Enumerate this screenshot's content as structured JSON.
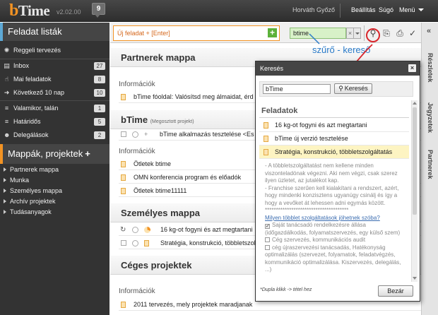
{
  "app": {
    "logo_mark": "b",
    "logo_text": "Time",
    "version": "v2.02.00",
    "notifications": "9"
  },
  "user": {
    "name": "Horváth Győző"
  },
  "topmenu": {
    "settings": "Beállítás",
    "help": "Súgó",
    "menu": "Menü"
  },
  "sidebar": {
    "tasks_title": "Feladat listák",
    "items": [
      {
        "label": "Reggeli tervezés",
        "icon": "sun-icon",
        "count": ""
      },
      {
        "label": "Inbox",
        "icon": "inbox-icon",
        "count": "27"
      },
      {
        "label": "Mai feladatok",
        "icon": "thumbs-up-icon",
        "count": "8"
      },
      {
        "label": "Következő 10 nap",
        "icon": "arrow-right-icon",
        "count": "10"
      },
      {
        "label": "Valamikor, talán",
        "icon": "bars-icon",
        "count": "1"
      },
      {
        "label": "Határidős",
        "icon": "bars-icon",
        "count": "5"
      },
      {
        "label": "Delegálások",
        "icon": "people-icon",
        "count": "2"
      }
    ],
    "folders_title": "Mappák, projektek",
    "folders_add": "+",
    "folders": [
      "Partnerek mappa",
      "Munka",
      "Személyes mappa",
      "Archív projektek",
      "Tudásanyagok"
    ]
  },
  "toolbar": {
    "new_task": "Új feladat + [Enter]",
    "new_task_add": "+",
    "search_value": "btime",
    "search_clear": "×"
  },
  "annotation": {
    "label": "szűrő - kereső"
  },
  "rail": {
    "collapse": "«",
    "tabs": [
      "Részletek",
      "Jegyzetek",
      "Partnerek"
    ]
  },
  "main": {
    "s1": {
      "title": "Partnerek mappa",
      "group": "Információk",
      "row": "bTime fóoldal: Valósítsd meg álmaidat, érd"
    },
    "s2": {
      "title": "bTime",
      "subtitle": "(Megosztott projekt)",
      "row": "bTime alkalmazás tesztelése <Es",
      "group": "Információk",
      "rows": [
        "Ötletek btime",
        "OMN konferencia program és előadók",
        "Ötletek btime11111"
      ]
    },
    "s3": {
      "title": "Személyes mappa",
      "rows": [
        "16 kg-ot fogyni és azt megtartani",
        "Stratégia, konstrukció, többletszolg"
      ]
    },
    "s4": {
      "title": "Céges projektek",
      "group": "Információk",
      "row": "2011 tervezés, mely projektek maradjanak"
    }
  },
  "dialog": {
    "title": "Keresés",
    "close": "×",
    "input": "bTime",
    "search_button": "Keresés",
    "section": "Feladatok",
    "results": [
      "16 kg-ot fogyni és azt megtartani",
      "bTime új verzió tesztelése",
      "Stratégia, konstrukció, többletszolgáltatás"
    ],
    "desc": [
      "- A többletszolgáltatást nem kellene minden viszonteladónak végezni. Aki nem végzi, csak szerez ilyen üzletet, az jutalékot kap.",
      "- Franchise szerűen kell kialakítani a rendszert, azért, hogy mindenki konzisztens ugyanúgy csinálj és így a hogy a vevőket át lehessen adni egymás között.",
      "**************************************"
    ],
    "link": "Milyen többlet szolgáltatások jöhetnek szóba?",
    "checks": [
      {
        "label": "Saját tanácsadó rendelkezésre állása (időgazdálkodás, folyamatszervezés, egy külső szem)",
        "checked": true
      },
      {
        "label": "Cég szervezés, kommunikációs audit",
        "checked": false
      },
      {
        "label": "cég újraszervezési tanácsadás, Hatékonyság optimalizálás (szervezet, folyamatok, feladatvégzés, kommunikáció optimalizálása. Kiszervezés, delegálás, ...)",
        "checked": false
      }
    ],
    "hint": "*Dupla klikk -> tétel hez",
    "close_button": "Bezár"
  }
}
